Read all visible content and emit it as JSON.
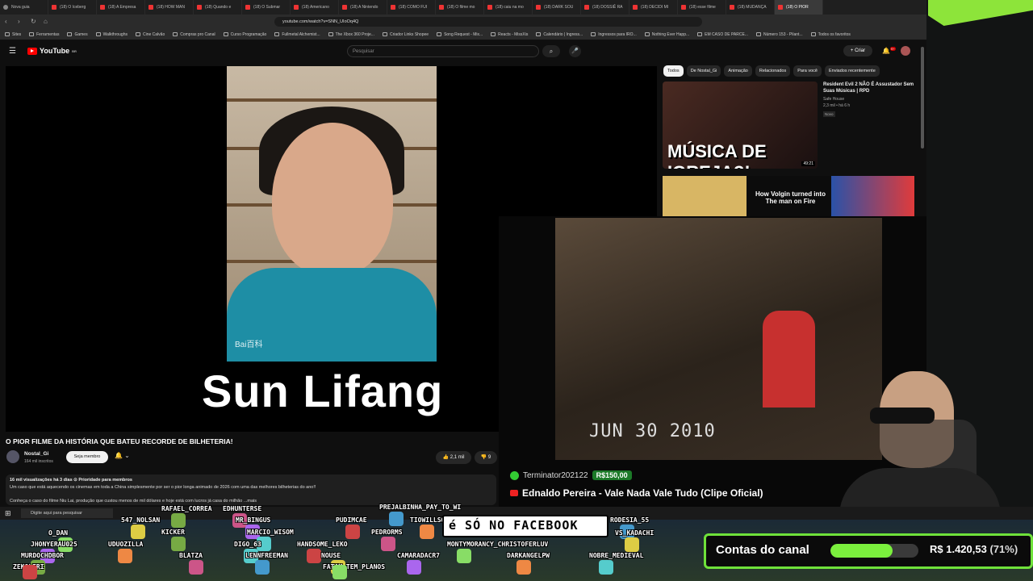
{
  "browser": {
    "tabs": [
      "Nova guia",
      "(18) O Iceberg",
      "(18) A Empresa",
      "(18) HOW MAN",
      "(18) Quando e",
      "(18) O Submar",
      "(18) Americano",
      "(18) A Nintendo",
      "(18) COMO FUI",
      "(18) O filme mo",
      "(18) caiu na mo",
      "(18) DARK SOU",
      "(18) DOSSIÊ RA",
      "(18) DECIDI MI",
      "(18) esse filme",
      "(18) MUDANÇA",
      "(18) O PIOR"
    ],
    "url": "youtube.com/watch?v=SNN_UIoOq4Q",
    "bookmarks": [
      "Sites",
      "Ferramentas",
      "Games",
      "Walkthroughs",
      "Cine Calvão",
      "Compras pro Canal",
      "Curso Programação",
      "Fullmetal Alchemist...",
      "The Xbox 360 Proje...",
      "Criador Links Shopee",
      "Song Request - Mix...",
      "Reacts - MissXis",
      "Calendário | Ingress...",
      "Ingressos para IRO...",
      "Nothing Ever Happ...",
      "EM CASO DE PARCE...",
      "Número 153 - Pilant...",
      "Todos os favoritos"
    ]
  },
  "youtube": {
    "logo": "YouTube",
    "logo_country": "BR",
    "search_placeholder": "Pesquisar",
    "create_label": "+ Criar",
    "notif_count": "9+",
    "video_overlay_name": "Sun Lifang",
    "video_watermark": "Bai百科",
    "video_title": "O PIOR FILME DA HISTÓRIA QUE BATEU RECORDE DE BILHETERIA!",
    "channel_name": "Nostal_Gi",
    "channel_subs": "164 mil inscritos",
    "join_label": "Seja membro",
    "likes": "2,1 mil",
    "dislikes": "9",
    "views_line": "16 mil visualizações  há 3 dias  ⊙ Prioridade para membros",
    "desc_line1": "Um caso que está aquecendo os cinemas em toda a China simplesmente por ser o pior longa animado de 2026 com uma das melhores bilheterias do ano!!",
    "desc_line2": "Conheça o caso do filme Niu Lai, produção que custou menos de mil dólares e hoje está com lucros já casa do milhão ...mais",
    "chips": [
      "Todos",
      "De Nostal_Gi",
      "Animação",
      "Relacionados",
      "Para você",
      "Enviados recentemente"
    ],
    "rec1": {
      "thumb_text": "MÚSICA DE IGREJA?!",
      "duration": "49:21",
      "title": "Resident Evil 2 NÃO É Assustador Sem Suas Músicas | RPD",
      "channel": "Safe House",
      "meta": "2,3 mil • há 6 h",
      "badge": "Novo"
    },
    "rec3_text": "How Volgin turned into The man on Fire"
  },
  "stream": {
    "clip_date": "JUN 30 2010",
    "donor": "Terminator202122",
    "donation": "R$150,00",
    "song": "Ednaldo Pereira - Vale Nada Vale Tudo (Clipe Oficial)"
  },
  "taskbar": {
    "search_placeholder": "Digite aqui para pesquisar"
  },
  "chat_overlay": {
    "bubble": "é SÓ NO FACEBOOK",
    "nicks": [
      "RAFAEL_CORREA",
      "EDHUNTERSE",
      "PREJALBINHA_PAY_TO_WI",
      "547_NOLSAN",
      "MR_BINGUS",
      "TIOWILLSON",
      "MARCIO_WISOM",
      "PUDIMCAE",
      "O_DAN",
      "KICKER",
      "PEDRORMS",
      "RODESIA_55",
      "VS_KADACHI",
      "JHONYERAU025",
      "UDUOZILLA",
      "DIGO_63",
      "HANDSOME_LEKO",
      "MONTYMORANCY_CHRISTOFERLUV",
      "MURDOCHDBOR",
      "BLATZA",
      "LENNFREEMAN",
      "NOUSE",
      "CAMARADACR7",
      "DARKANGELPW",
      "NOBRE_MEDIEVAL",
      "ZEKOLERI",
      "FATAM_TEM_PLANOS"
    ]
  },
  "goal": {
    "label": "Contas do canal",
    "value": "R$ 1.420,53",
    "percent_label": "(71%)",
    "fraction": 0.71
  },
  "colors": {
    "youtube_red": "#ff0000",
    "goal_green": "#7bf03d",
    "donation_green": "#1c7a28"
  }
}
